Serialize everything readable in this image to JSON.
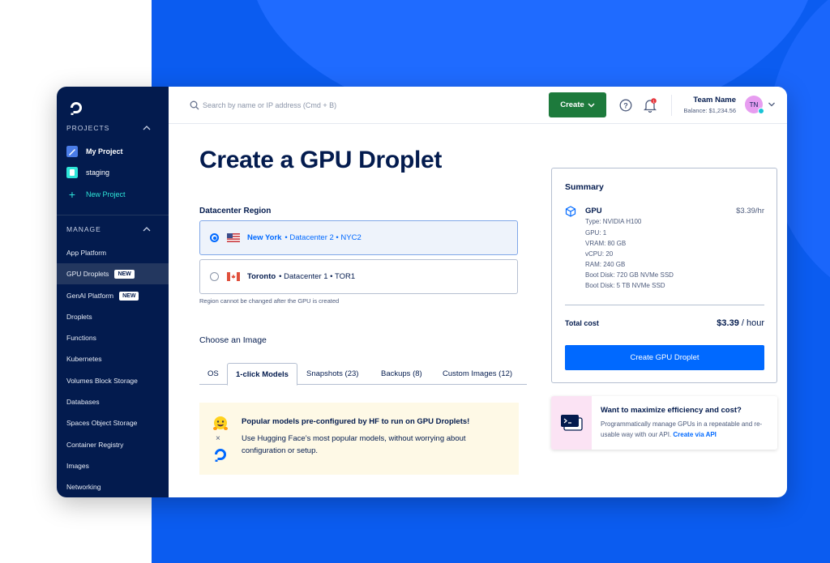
{
  "sidebar": {
    "projects_header": "PROJECTS",
    "projects": [
      {
        "label": "My Project",
        "icon": "project-pencil-icon"
      },
      {
        "label": "staging",
        "icon": "project-bucket-icon"
      }
    ],
    "new_project": "New Project",
    "manage_header": "MANAGE",
    "nav": [
      {
        "label": "App Platform"
      },
      {
        "label": "GPU Droplets",
        "badge": "NEW"
      },
      {
        "label": "GenAI Platform",
        "badge": "NEW"
      },
      {
        "label": "Droplets"
      },
      {
        "label": "Functions"
      },
      {
        "label": "Kubernetes"
      },
      {
        "label": "Volumes Block Storage"
      },
      {
        "label": "Databases"
      },
      {
        "label": "Spaces Object Storage"
      },
      {
        "label": "Container Registry"
      },
      {
        "label": "Images"
      },
      {
        "label": "Networking"
      }
    ]
  },
  "topbar": {
    "search_placeholder": "Search by name or IP address (Cmd + B)",
    "create_label": "Create",
    "team_name": "Team Name",
    "balance": "Balance: $1,234.56",
    "avatar_initials": "TN",
    "notification_count": "1"
  },
  "main": {
    "title": "Create a GPU Droplet",
    "region_label": "Datacenter Region",
    "regions": [
      {
        "city": "New York",
        "rest": "•  Datacenter 2  •  NYC2",
        "selected": true,
        "flag": "us-flag-icon"
      },
      {
        "city": "Toronto",
        "rest": "•  Datacenter 1  •  TOR1",
        "selected": false,
        "flag": "ca-flag-icon"
      }
    ],
    "region_hint": "Region cannot be changed after the GPU is created",
    "image_label": "Choose an Image",
    "tabs": [
      "OS",
      "1-click Models",
      "Snapshots (23)",
      "Backups (8)",
      "Custom Images (12)"
    ],
    "active_tab": "1-click Models",
    "hf_title": "Popular models pre-configured by HF to run on GPU Droplets!",
    "hf_body": "Use Hugging Face’s most popular models, without worrying about configuration or setup.",
    "hf_separator": "×"
  },
  "summary": {
    "title": "Summary",
    "item": "GPU",
    "price": "$3.39/hr",
    "specs": [
      "Type: NVIDIA H100",
      "GPU: 1",
      "VRAM: 80 GB",
      "vCPU: 20",
      "RAM: 240 GB",
      "Boot Disk: 720 GB NVMe SSD",
      "Boot Disk: 5 TB NVMe SSD"
    ],
    "total_label": "Total cost",
    "total_value": "$3.39",
    "total_unit": " / hour",
    "button": "Create GPU Droplet"
  },
  "api_card": {
    "title": "Want to maximize efficiency and cost?",
    "body": "Programmatically manage GPUs in a repeatable and re-usable way with our API.",
    "link": "Create via API"
  },
  "colors": {
    "brand_blue": "#0069ff",
    "sidebar_navy": "#031b4e",
    "create_green": "#1d7a3c",
    "new_project_teal": "#2ee5d8",
    "hf_box_yellow": "#fef9e6"
  }
}
